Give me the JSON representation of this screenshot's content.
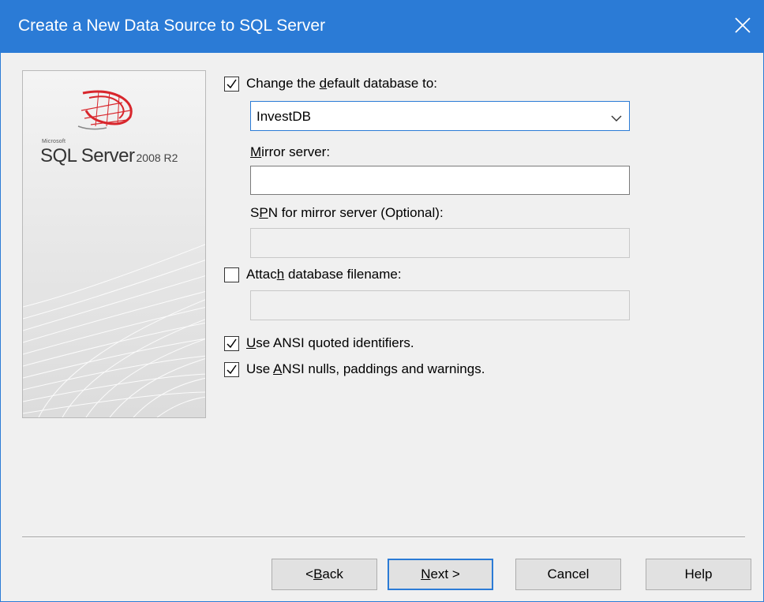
{
  "window": {
    "title": "Create a New Data Source to SQL Server",
    "close_glyph": "✕"
  },
  "branding": {
    "microsoft": "Microsoft",
    "product": "SQL Server",
    "version": "2008 R2"
  },
  "options": {
    "change_default_db": {
      "checked": true,
      "label_pre": "Change the ",
      "label_u": "d",
      "label_post": "efault database to:"
    },
    "database_combo": {
      "value": "InvestDB"
    },
    "mirror_server": {
      "label_u": "M",
      "label_post": "irror server:",
      "value": ""
    },
    "spn": {
      "label_pre": "S",
      "label_u": "P",
      "label_post": "N for mirror server (Optional):",
      "value": "",
      "enabled": false
    },
    "attach_db": {
      "checked": false,
      "label_pre": "Attac",
      "label_u": "h",
      "label_post": " database filename:",
      "value": "",
      "enabled": false
    },
    "ansi_quoted": {
      "checked": true,
      "label_u": "U",
      "label_post": "se ANSI quoted identifiers."
    },
    "ansi_nulls": {
      "checked": true,
      "label_pre": "Use ",
      "label_u": "A",
      "label_post": "NSI nulls, paddings and warnings."
    }
  },
  "buttons": {
    "back_pre": "< ",
    "back_u": "B",
    "back_post": "ack",
    "next_u": "N",
    "next_post": "ext >",
    "cancel": "Cancel",
    "help": "Help"
  },
  "colors": {
    "titlebar": "#2b7bd6",
    "background": "#f0f0f0",
    "logo_red": "#d8262c"
  },
  "icons": {
    "close": "close-icon",
    "dropdown": "chevron-down-icon",
    "check": "checkmark-icon",
    "logo": "sql-server-logo-icon"
  }
}
